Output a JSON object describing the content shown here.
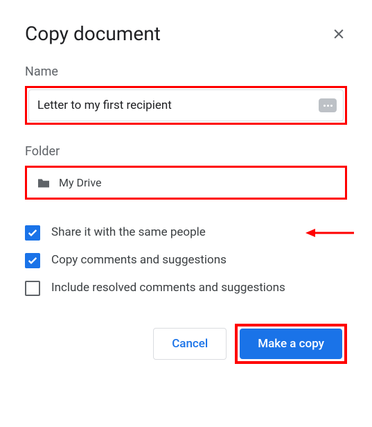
{
  "dialog": {
    "title": "Copy document",
    "name_label": "Name",
    "name_value": "Letter to my first recipient",
    "folder_label": "Folder",
    "folder_name": "My Drive",
    "checkboxes": [
      {
        "label": "Share it with the same people",
        "checked": true
      },
      {
        "label": "Copy comments and suggestions",
        "checked": true
      },
      {
        "label": "Include resolved comments and suggestions",
        "checked": false
      }
    ],
    "cancel_label": "Cancel",
    "primary_label": "Make a copy"
  }
}
